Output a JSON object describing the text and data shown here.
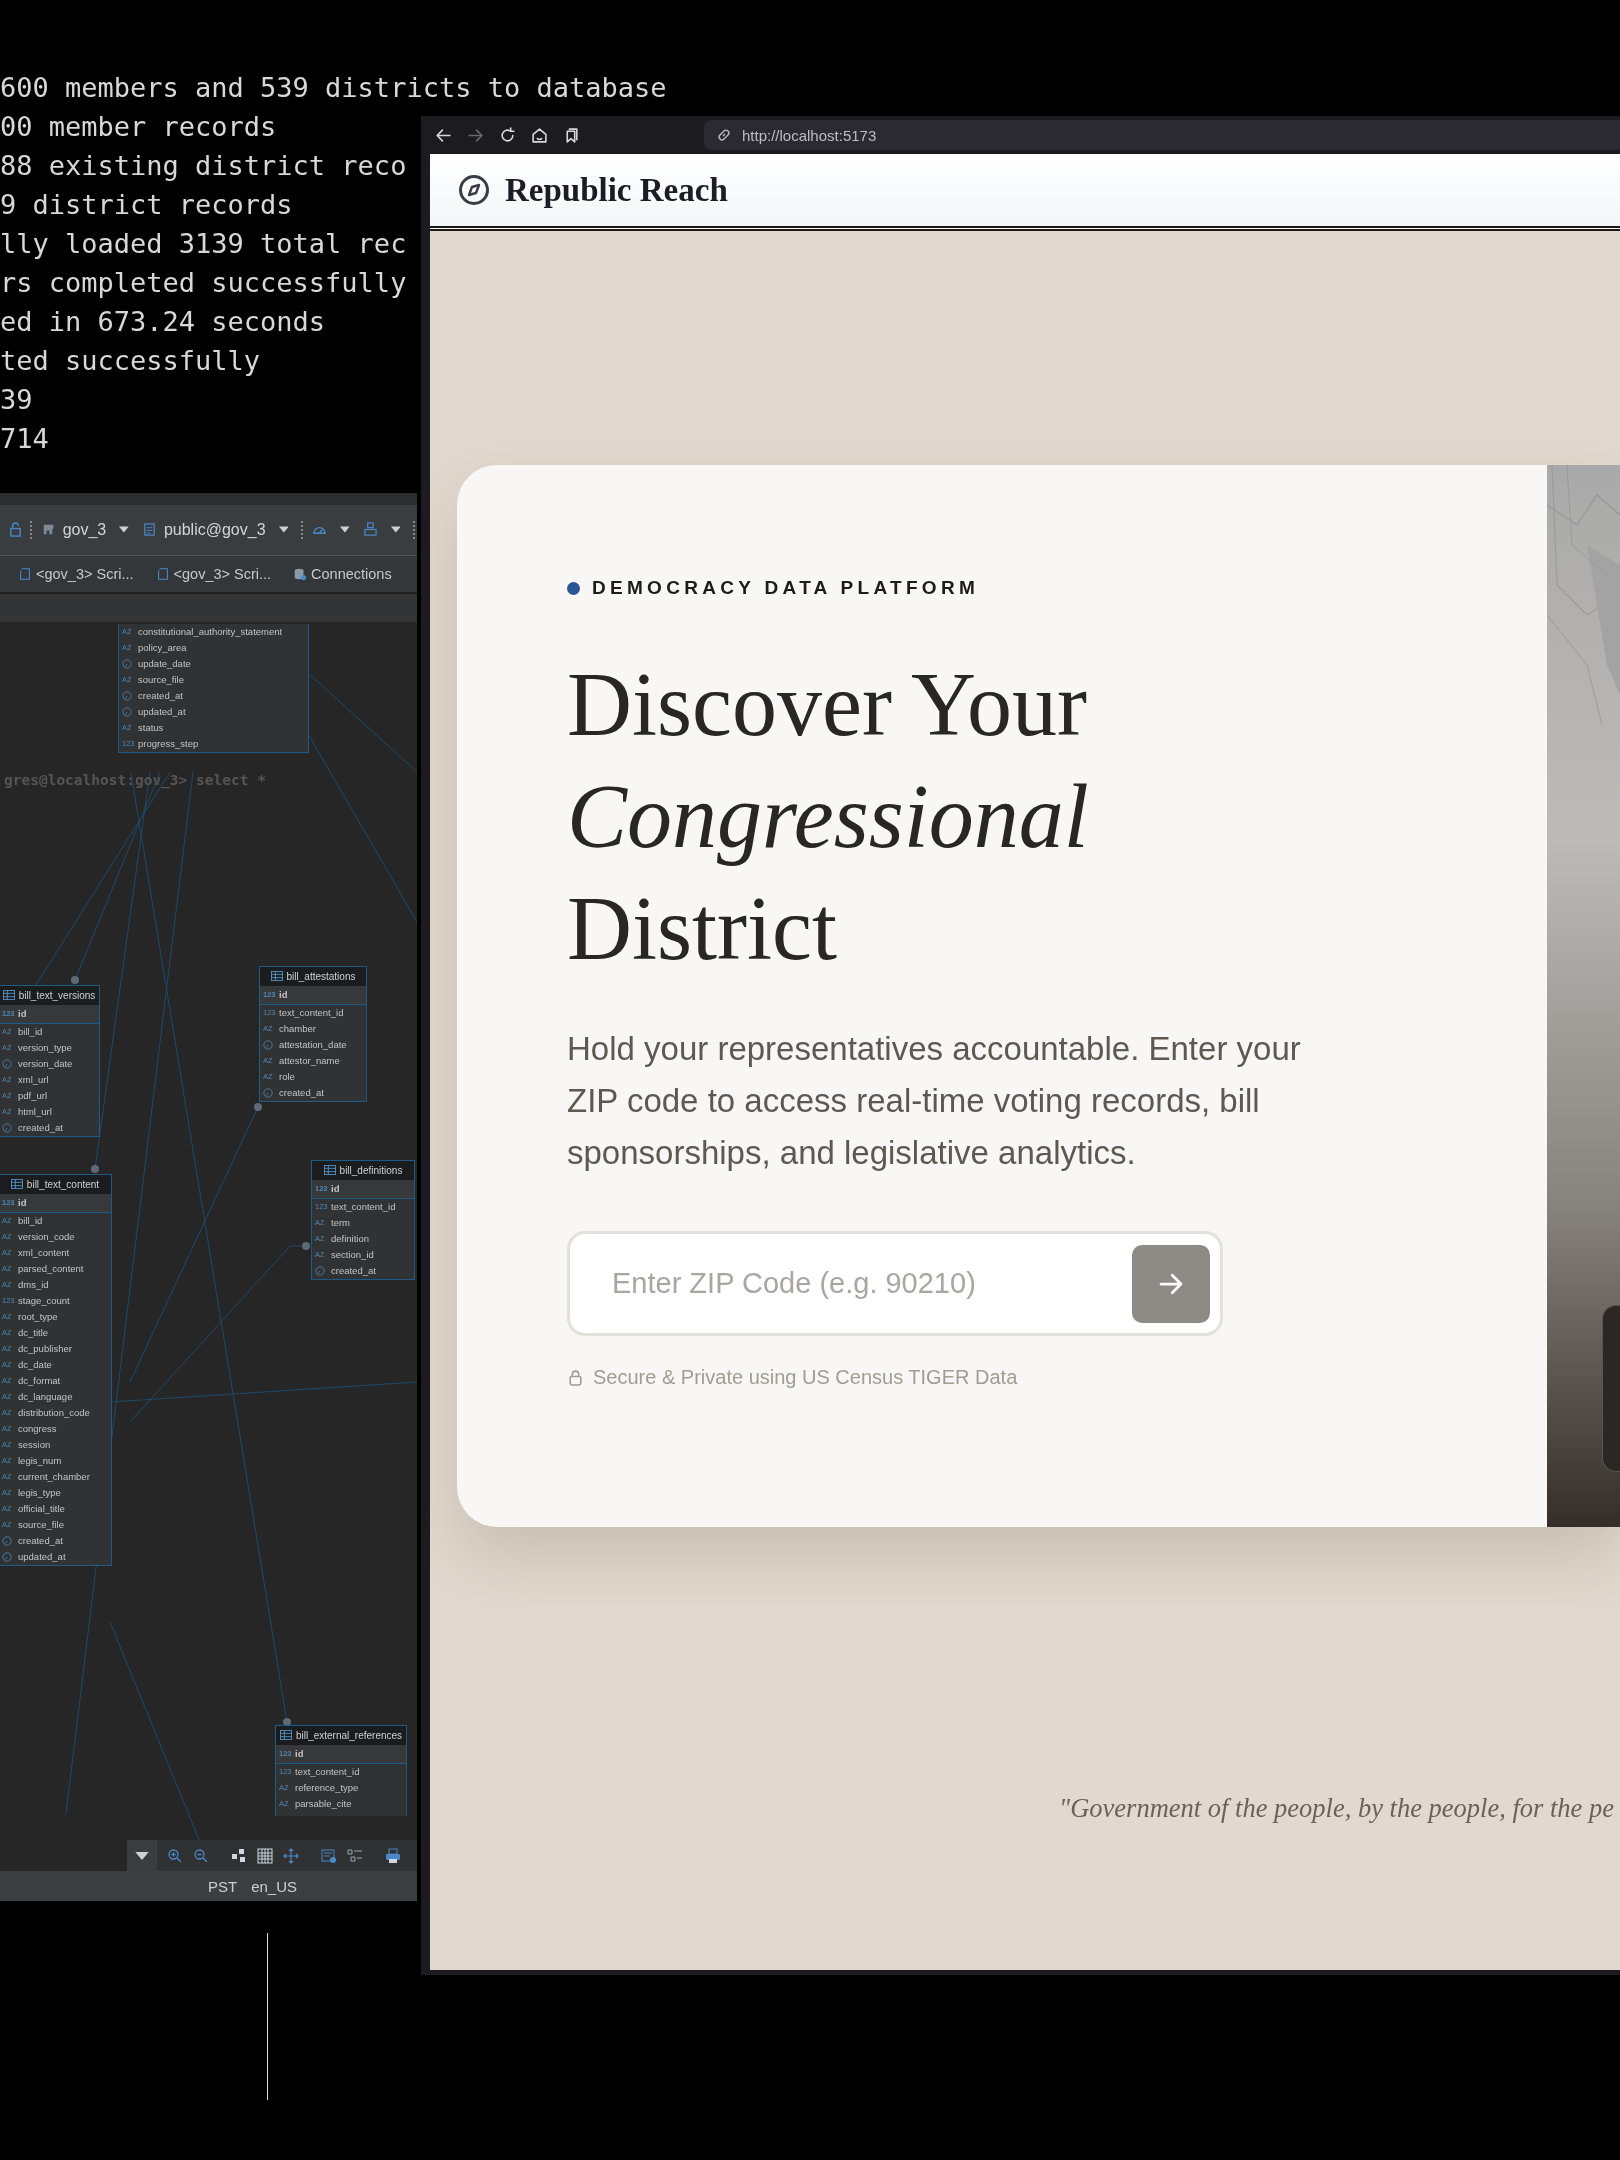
{
  "terminal": {
    "lines": [
      "600 members and 539 districts to database",
      "00 member records",
      "88 existing district reco",
      "9 district records",
      "lly loaded 3139 total rec",
      "rs completed successfully",
      "ed in 673.24 seconds",
      "ted successfully",
      "39",
      "714"
    ]
  },
  "db_window": {
    "toolbar": {
      "connection": "gov_3",
      "schema": "public@gov_3"
    },
    "tabs": [
      {
        "label": "<gov_3> Scri...",
        "kind": "script"
      },
      {
        "label": "<gov_3> Scri...",
        "kind": "script"
      },
      {
        "label": "Connections",
        "kind": "connections"
      }
    ],
    "query_text": "gres@localhost:gov_3> select *",
    "tables": [
      {
        "columns": [
          {
            "name": "constitutional_authority_statement",
            "kind": "text",
            "badge": "AZ"
          },
          {
            "name": "policy_area",
            "kind": "text",
            "badge": "AZ"
          },
          {
            "name": "update_date",
            "kind": "date"
          },
          {
            "name": "source_file",
            "kind": "text",
            "badge": "AZ"
          },
          {
            "name": "created_at",
            "kind": "date"
          },
          {
            "name": "updated_at",
            "kind": "date"
          },
          {
            "name": "status",
            "kind": "text",
            "badge": "AZ"
          },
          {
            "name": "progress_step",
            "kind": "number",
            "badge": "123"
          }
        ]
      },
      {
        "name": "bill_text_versions",
        "key": {
          "name": "id",
          "badge": "123"
        },
        "columns": [
          {
            "name": "bill_id",
            "kind": "text",
            "badge": "AZ"
          },
          {
            "name": "version_type",
            "kind": "text",
            "badge": "AZ"
          },
          {
            "name": "version_date",
            "kind": "date"
          },
          {
            "name": "xml_url",
            "kind": "text",
            "badge": "AZ"
          },
          {
            "name": "pdf_url",
            "kind": "text",
            "badge": "AZ"
          },
          {
            "name": "html_url",
            "kind": "text",
            "badge": "AZ"
          },
          {
            "name": "created_at",
            "kind": "date"
          }
        ]
      },
      {
        "name": "bill_attestations",
        "key": {
          "name": "id",
          "badge": "123"
        },
        "columns": [
          {
            "name": "text_content_id",
            "kind": "number",
            "badge": "123"
          },
          {
            "name": "chamber",
            "kind": "text",
            "badge": "AZ"
          },
          {
            "name": "attestation_date",
            "kind": "date"
          },
          {
            "name": "attestor_name",
            "kind": "text",
            "badge": "AZ"
          },
          {
            "name": "role",
            "kind": "text",
            "badge": "AZ"
          },
          {
            "name": "created_at",
            "kind": "date"
          }
        ]
      },
      {
        "name": "bill_text_content",
        "key": {
          "name": "id",
          "badge": "123"
        },
        "columns": [
          {
            "name": "bill_id",
            "kind": "text",
            "badge": "AZ"
          },
          {
            "name": "version_code",
            "kind": "text",
            "badge": "AZ"
          },
          {
            "name": "xml_content",
            "kind": "text",
            "badge": "AZ"
          },
          {
            "name": "parsed_content",
            "kind": "text",
            "badge": "AZ"
          },
          {
            "name": "dms_id",
            "kind": "text",
            "badge": "AZ"
          },
          {
            "name": "stage_count",
            "kind": "number",
            "badge": "123"
          },
          {
            "name": "root_type",
            "kind": "text",
            "badge": "AZ"
          },
          {
            "name": "dc_title",
            "kind": "text",
            "badge": "AZ"
          },
          {
            "name": "dc_publisher",
            "kind": "text",
            "badge": "AZ"
          },
          {
            "name": "dc_date",
            "kind": "text",
            "badge": "AZ"
          },
          {
            "name": "dc_format",
            "kind": "text",
            "badge": "AZ"
          },
          {
            "name": "dc_language",
            "kind": "text",
            "badge": "AZ"
          },
          {
            "name": "distribution_code",
            "kind": "text",
            "badge": "AZ"
          },
          {
            "name": "congress",
            "kind": "text",
            "badge": "AZ"
          },
          {
            "name": "session",
            "kind": "text",
            "badge": "AZ"
          },
          {
            "name": "legis_num",
            "kind": "text",
            "badge": "AZ"
          },
          {
            "name": "current_chamber",
            "kind": "text",
            "badge": "AZ"
          },
          {
            "name": "legis_type",
            "kind": "text",
            "badge": "AZ"
          },
          {
            "name": "official_title",
            "kind": "text",
            "badge": "AZ"
          },
          {
            "name": "source_file",
            "kind": "text",
            "badge": "AZ"
          },
          {
            "name": "created_at",
            "kind": "date"
          },
          {
            "name": "updated_at",
            "kind": "date"
          }
        ]
      },
      {
        "name": "bill_definitions",
        "key": {
          "name": "id",
          "badge": "123"
        },
        "columns": [
          {
            "name": "text_content_id",
            "kind": "number",
            "badge": "123"
          },
          {
            "name": "term",
            "kind": "text",
            "badge": "AZ"
          },
          {
            "name": "definition",
            "kind": "text",
            "badge": "AZ"
          },
          {
            "name": "section_id",
            "kind": "text",
            "badge": "AZ"
          },
          {
            "name": "created_at",
            "kind": "date"
          }
        ]
      },
      {
        "name": "bill_external_references",
        "key": {
          "name": "id",
          "badge": "123"
        },
        "columns": [
          {
            "name": "text_content_id",
            "kind": "number",
            "badge": "123"
          },
          {
            "name": "reference_type",
            "kind": "text",
            "badge": "AZ"
          },
          {
            "name": "parsable_cite",
            "kind": "text",
            "badge": "AZ"
          }
        ]
      }
    ],
    "status_bar": [
      "PST",
      "en_US"
    ]
  },
  "browser": {
    "nav_buttons": [
      {
        "kind": "back",
        "disabled": false
      },
      {
        "kind": "forward",
        "disabled": true
      },
      {
        "kind": "reload",
        "disabled": false
      },
      {
        "kind": "home",
        "disabled": false
      },
      {
        "kind": "bookmarks",
        "disabled": false
      }
    ],
    "url": "http://localhost:5173"
  },
  "site": {
    "brand": "Republic Reach",
    "eyebrow": "DEMOCRACY DATA PLATFORM",
    "title": "Discover Your *Congressional* District",
    "lede": "Hold your representatives accountable. Enter your ZIP code to access real-time voting records, bill sponsorships, and legislative analytics.",
    "zip_placeholder": "Enter ZIP Code (e.g. 90210)",
    "secure_note": "Secure & Private using US Census TIGER Data",
    "quote": "\"Government of the people, by the people, for the pe"
  }
}
